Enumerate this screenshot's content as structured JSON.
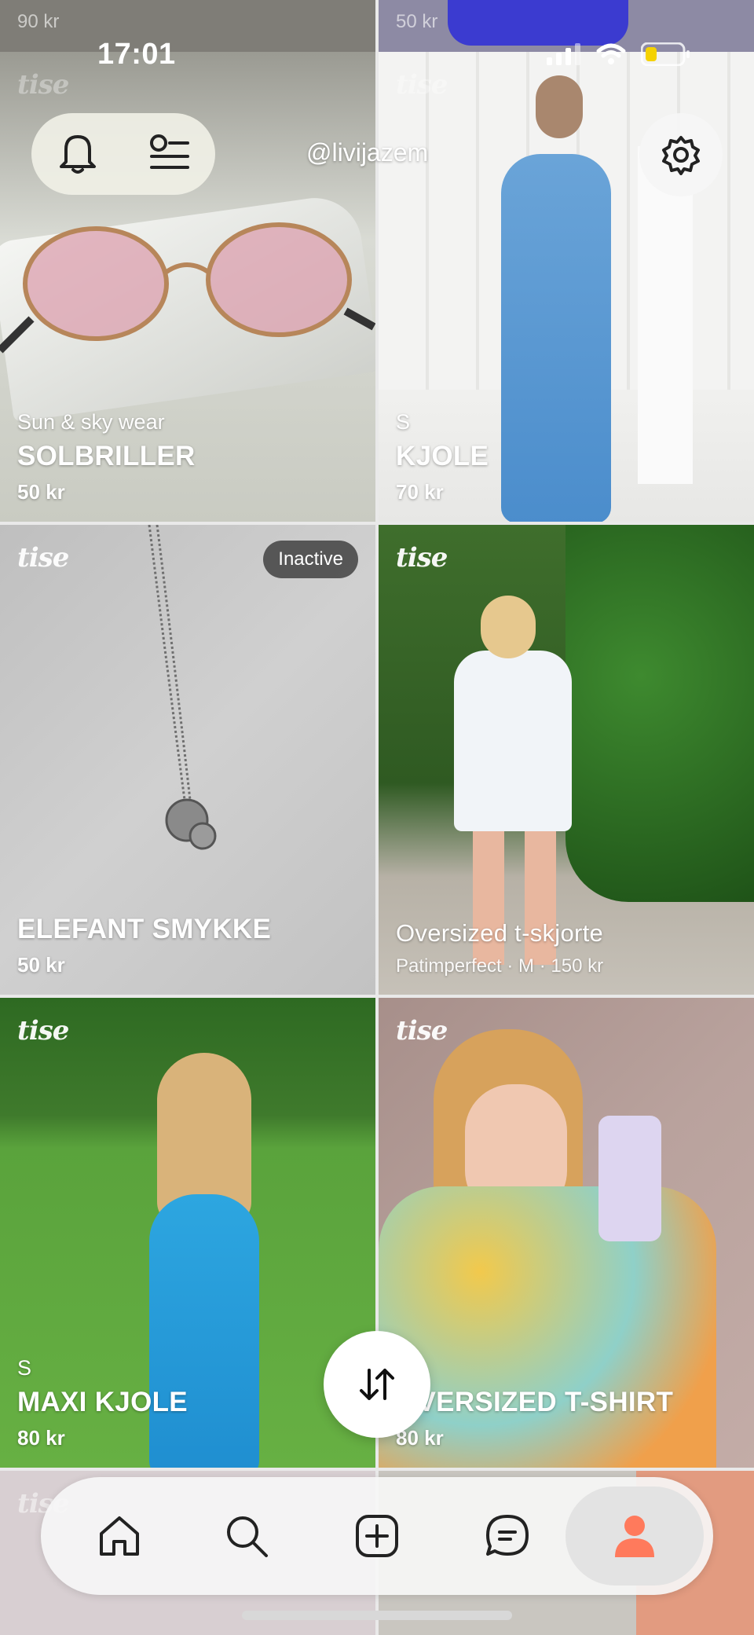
{
  "status": {
    "time": "17:01"
  },
  "header": {
    "username": "@livijazem",
    "icons": [
      "bell-icon",
      "filter-list-icon",
      "gear-icon"
    ]
  },
  "brand": "tise",
  "top_partial": {
    "left_price": "90 kr",
    "right_price": "50 kr"
  },
  "listings": [
    {
      "subtitle": "Sun & sky wear",
      "title": "SOLBRILLER",
      "price": "50 kr"
    },
    {
      "subtitle": "S",
      "title": "KJOLE",
      "price": "70 kr"
    },
    {
      "title": "ELEFANT SMYKKE",
      "price": "50 kr",
      "badge": "Inactive"
    },
    {
      "title": "Oversized t-skjorte",
      "detail": "Patimperfect · M · 150 kr"
    },
    {
      "subtitle": "S",
      "title": "MAXI KJOLE",
      "price": "80 kr"
    },
    {
      "title": "OVERSIZED T-SHIRT",
      "price": "80 kr"
    }
  ],
  "nav": {
    "items": [
      "home-icon",
      "search-icon",
      "add-listing-icon",
      "messages-icon",
      "profile-icon"
    ],
    "active": "profile-icon",
    "accent": "#ff7a5c"
  }
}
